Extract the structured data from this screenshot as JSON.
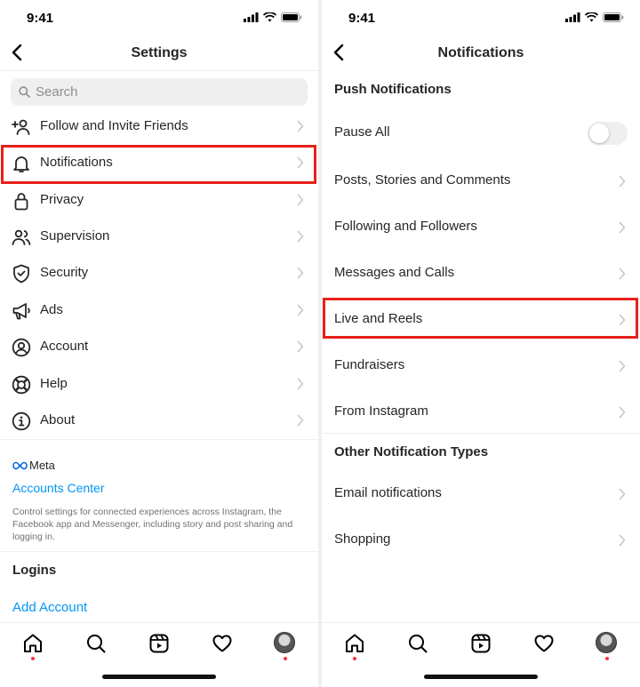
{
  "left": {
    "time": "9:41",
    "title": "Settings",
    "search_placeholder": "Search",
    "items": [
      {
        "label": "Follow and Invite Friends",
        "icon": "add-person-icon"
      },
      {
        "label": "Notifications",
        "icon": "bell-icon"
      },
      {
        "label": "Privacy",
        "icon": "lock-icon"
      },
      {
        "label": "Supervision",
        "icon": "people-icon"
      },
      {
        "label": "Security",
        "icon": "shield-icon"
      },
      {
        "label": "Ads",
        "icon": "megaphone-icon"
      },
      {
        "label": "Account",
        "icon": "person-circle-icon"
      },
      {
        "label": "Help",
        "icon": "lifebuoy-icon"
      },
      {
        "label": "About",
        "icon": "info-icon"
      }
    ],
    "meta_brand": "Meta",
    "accounts_center": "Accounts Center",
    "meta_description": "Control settings for connected experiences across Instagram, the Facebook app and Messenger, including story and post sharing and logging in.",
    "logins_heading": "Logins",
    "add_account": "Add Account"
  },
  "right": {
    "time": "9:41",
    "title": "Notifications",
    "push_heading": "Push Notifications",
    "pause_all": "Pause All",
    "pause_all_on": false,
    "push_items": [
      "Posts, Stories and Comments",
      "Following and Followers",
      "Messages and Calls",
      "Live and Reels",
      "Fundraisers",
      "From Instagram"
    ],
    "other_heading": "Other Notification Types",
    "other_items": [
      "Email notifications",
      "Shopping"
    ]
  },
  "tabbar": [
    "home-icon",
    "search-icon",
    "reels-icon",
    "heart-icon",
    "profile-avatar"
  ],
  "colors": {
    "highlight": "#e8201a",
    "link": "#0095f6",
    "notification_dot": "#ff3040"
  }
}
